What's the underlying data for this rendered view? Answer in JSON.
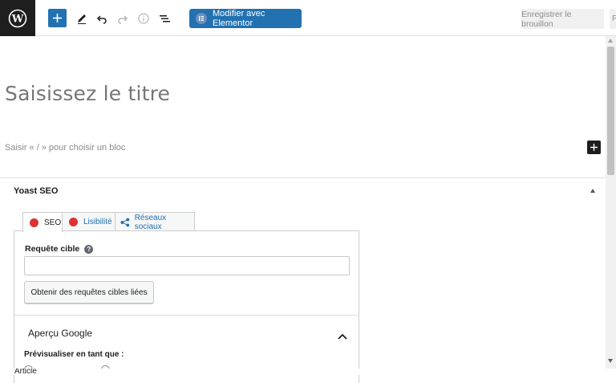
{
  "toolbar": {
    "logo_icon": "wordpress-logo",
    "add_icon": "plus-icon",
    "tools": [
      "pencil-icon",
      "undo-icon",
      "redo-icon",
      "info-icon",
      "list-view-icon"
    ],
    "elementor_label": "Modifier avec Elementor",
    "save_draft_label": "Enregistrer le brouillon",
    "publish_label": "P",
    "accent": "#2271b1"
  },
  "editor": {
    "title_placeholder": "Saisissez le titre",
    "block_placeholder": "Saisir « / » pour choisir un bloc"
  },
  "yoast": {
    "title": "Yoast SEO",
    "tabs": [
      {
        "label": "SEO",
        "icon": "red-dot"
      },
      {
        "label": "Lisibilité",
        "icon": "red-dot"
      },
      {
        "label": "Réseaux sociaux",
        "icon": "share-icon"
      }
    ],
    "status_color": "#dc3232",
    "keyphrase_label": "Requête cible",
    "keyphrase_value": "",
    "related_button": "Obtenir des requêtes cibles liées",
    "preview_title": "Aperçu Google",
    "preview_as_label": "Prévisualiser en tant que :"
  },
  "footer": {
    "label": "Article"
  }
}
